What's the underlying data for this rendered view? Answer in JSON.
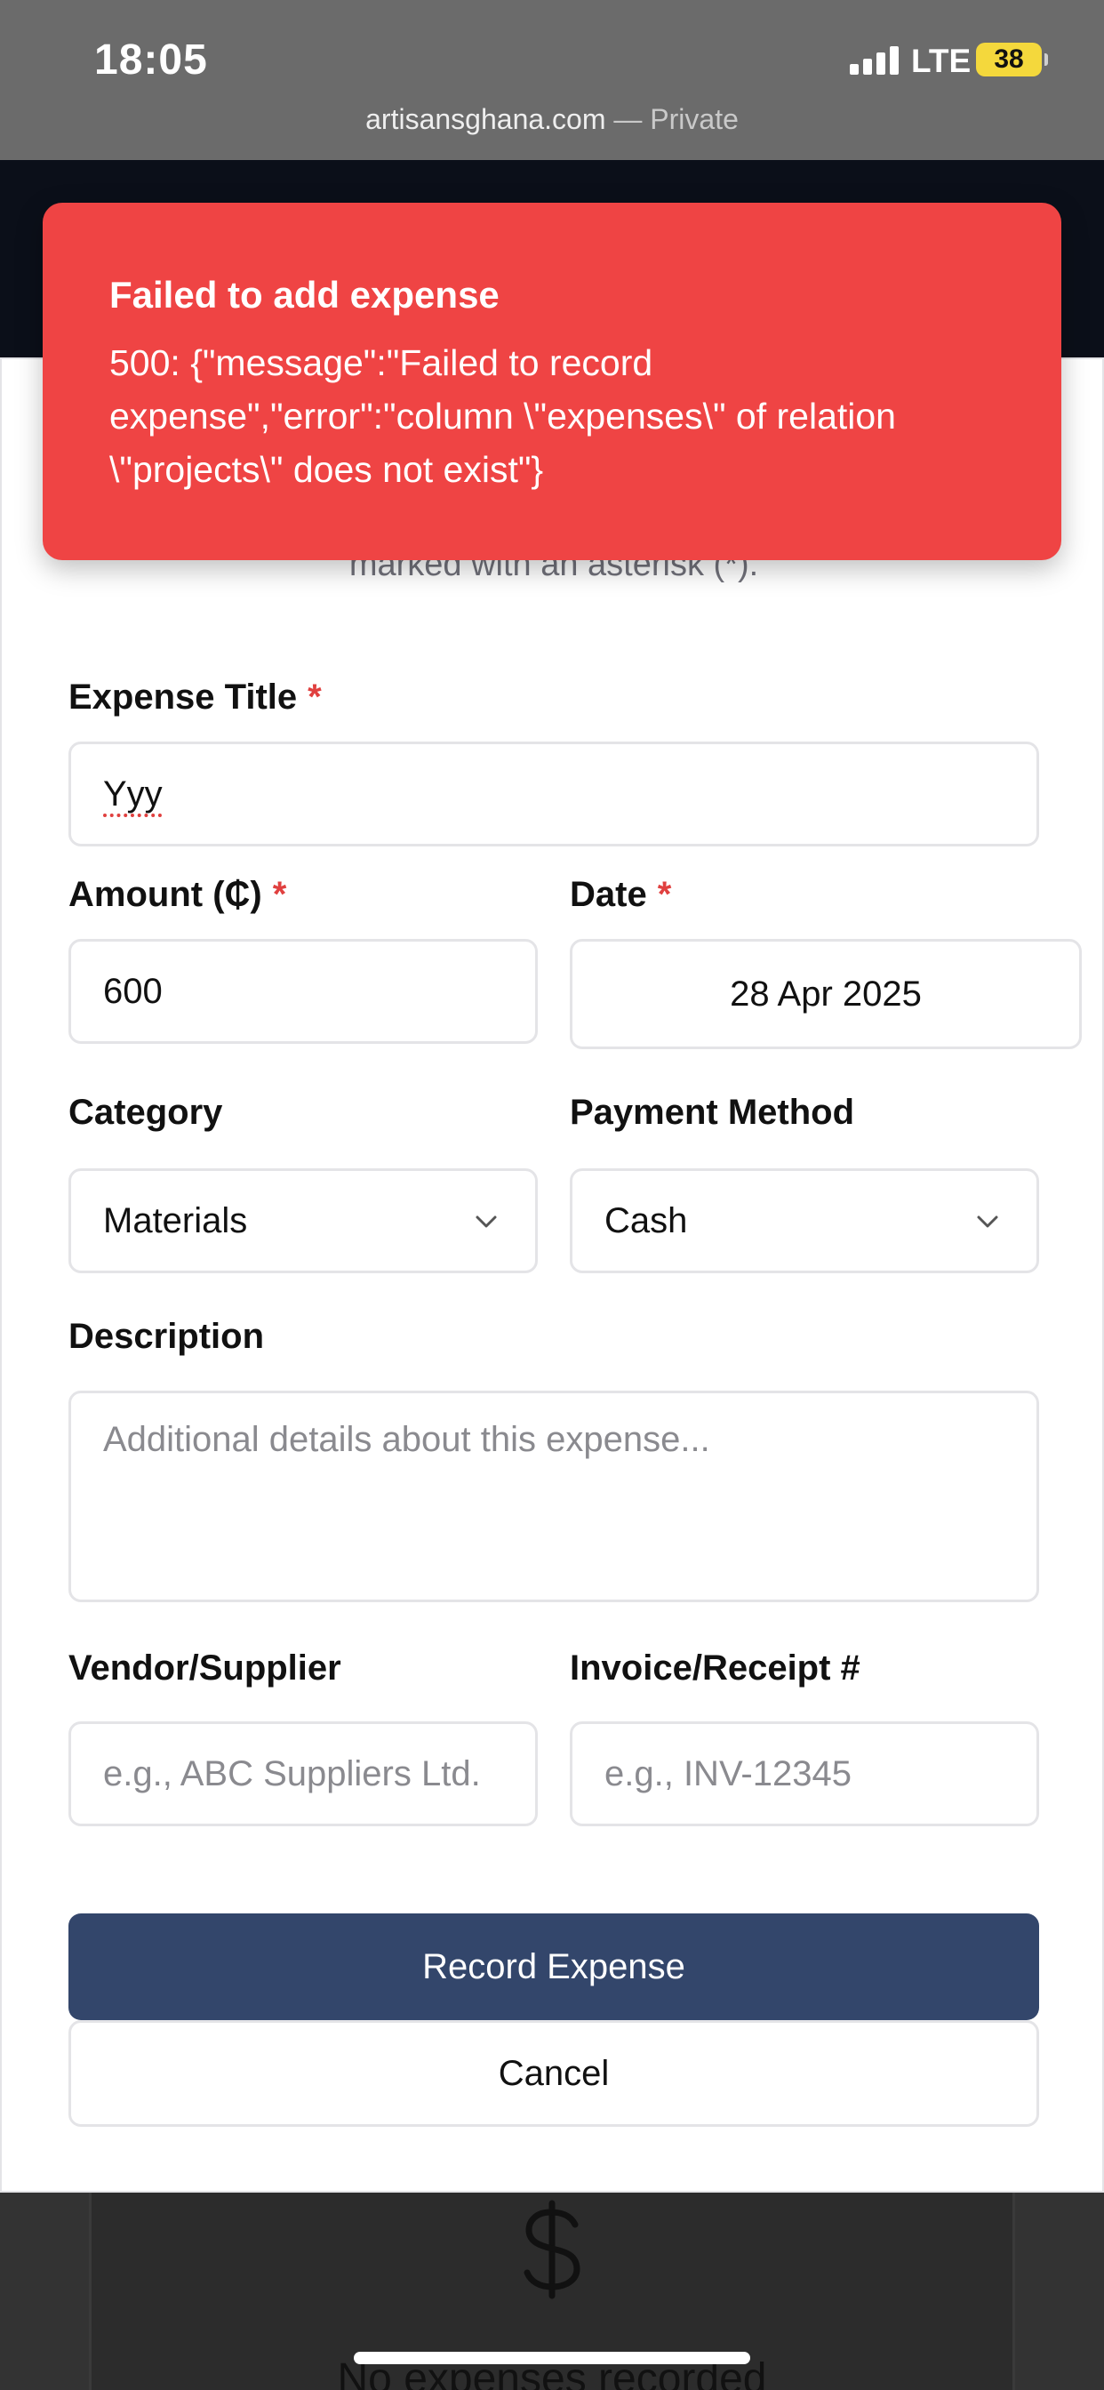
{
  "status_bar": {
    "time": "18:05",
    "network": "LTE",
    "battery": "38"
  },
  "browser": {
    "domain": "artisansghana.com",
    "private_label": "— Private"
  },
  "toast": {
    "title": "Failed to add expense",
    "message": "500: {\"message\":\"Failed to record expense\",\"error\":\"column \\\"expenses\\\" of relation \\\"projects\\\" does not exist\"}"
  },
  "form": {
    "intro_visible": "marked with an asterisk (*).",
    "required_marker": "*",
    "title": {
      "label": "Expense Title",
      "value": "Yyy"
    },
    "amount": {
      "label": "Amount (₵)",
      "value": "600"
    },
    "date": {
      "label": "Date",
      "value": "28 Apr 2025"
    },
    "category": {
      "label": "Category",
      "value": "Materials"
    },
    "payment_method": {
      "label": "Payment Method",
      "value": "Cash"
    },
    "description": {
      "label": "Description",
      "placeholder": "Additional details about this expense..."
    },
    "vendor": {
      "label": "Vendor/Supplier",
      "placeholder": "e.g., ABC Suppliers Ltd."
    },
    "invoice": {
      "label": "Invoice/Receipt #",
      "placeholder": "e.g., INV-12345"
    },
    "submit_label": "Record Expense",
    "cancel_label": "Cancel"
  },
  "background": {
    "empty_text": "No expenses recorded",
    "icon": "dollar-icon"
  },
  "colors": {
    "toast": "#ef4444",
    "primary_button": "#33466b",
    "required": "#e0403f"
  }
}
